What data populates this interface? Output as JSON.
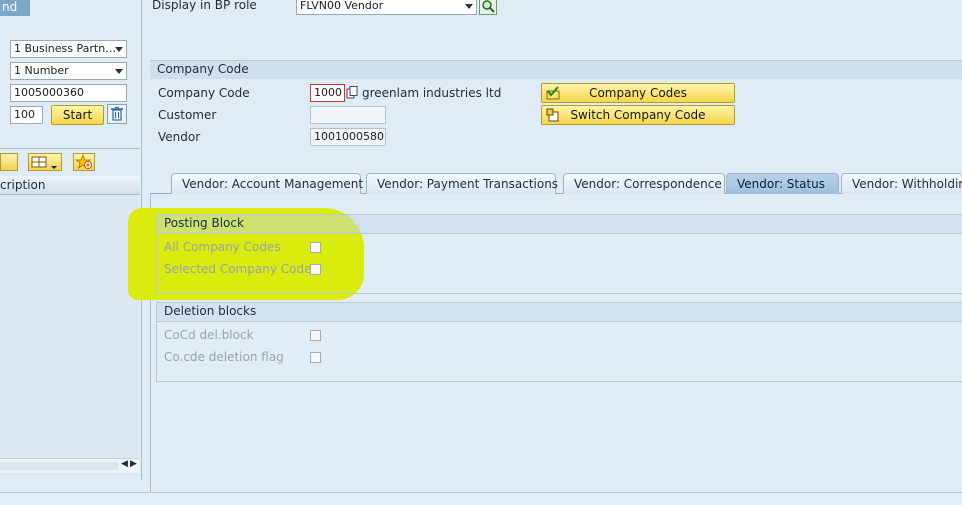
{
  "left_panel": {
    "top_tab_label": "nd",
    "fields": {
      "category": "1 Business Partn…",
      "by": "1 Number",
      "bp_number": "1005000360",
      "max_hits": "100",
      "start_button": "Start"
    },
    "table_header": "cription"
  },
  "header": {
    "display_label": "Display in BP role",
    "role_value": "FLVN00 Vendor"
  },
  "company_code_section": {
    "title": "Company Code",
    "company_code_label": "Company Code",
    "company_code_value": "1000",
    "company_name": "greenlam industries ltd",
    "customer_label": "Customer",
    "customer_value": "",
    "vendor_label": "Vendor",
    "vendor_value": "1001000580",
    "company_codes_button": "Company Codes",
    "switch_company_code_button": "Switch Company Code"
  },
  "tabs": [
    {
      "label": "Vendor: Account Management",
      "active": false
    },
    {
      "label": "Vendor: Payment Transactions",
      "active": false
    },
    {
      "label": "Vendor: Correspondence",
      "active": false
    },
    {
      "label": "Vendor: Status",
      "active": true
    },
    {
      "label": "Vendor: Withholding",
      "active": false
    }
  ],
  "posting_block": {
    "title": "Posting Block",
    "all_company_codes": "All Company Codes",
    "selected_company_code": "Selected Company Code"
  },
  "deletion_blocks": {
    "title": "Deletion blocks",
    "cocd_del_block": "CoCd del.block",
    "cocde_deletion_flag": "Co.cde deletion flag"
  },
  "colors": {
    "background": "#dfebf5",
    "highlight": "#d9ec00",
    "button_yellow": "#f4d64e",
    "active_tab": "#9dbfdd"
  }
}
